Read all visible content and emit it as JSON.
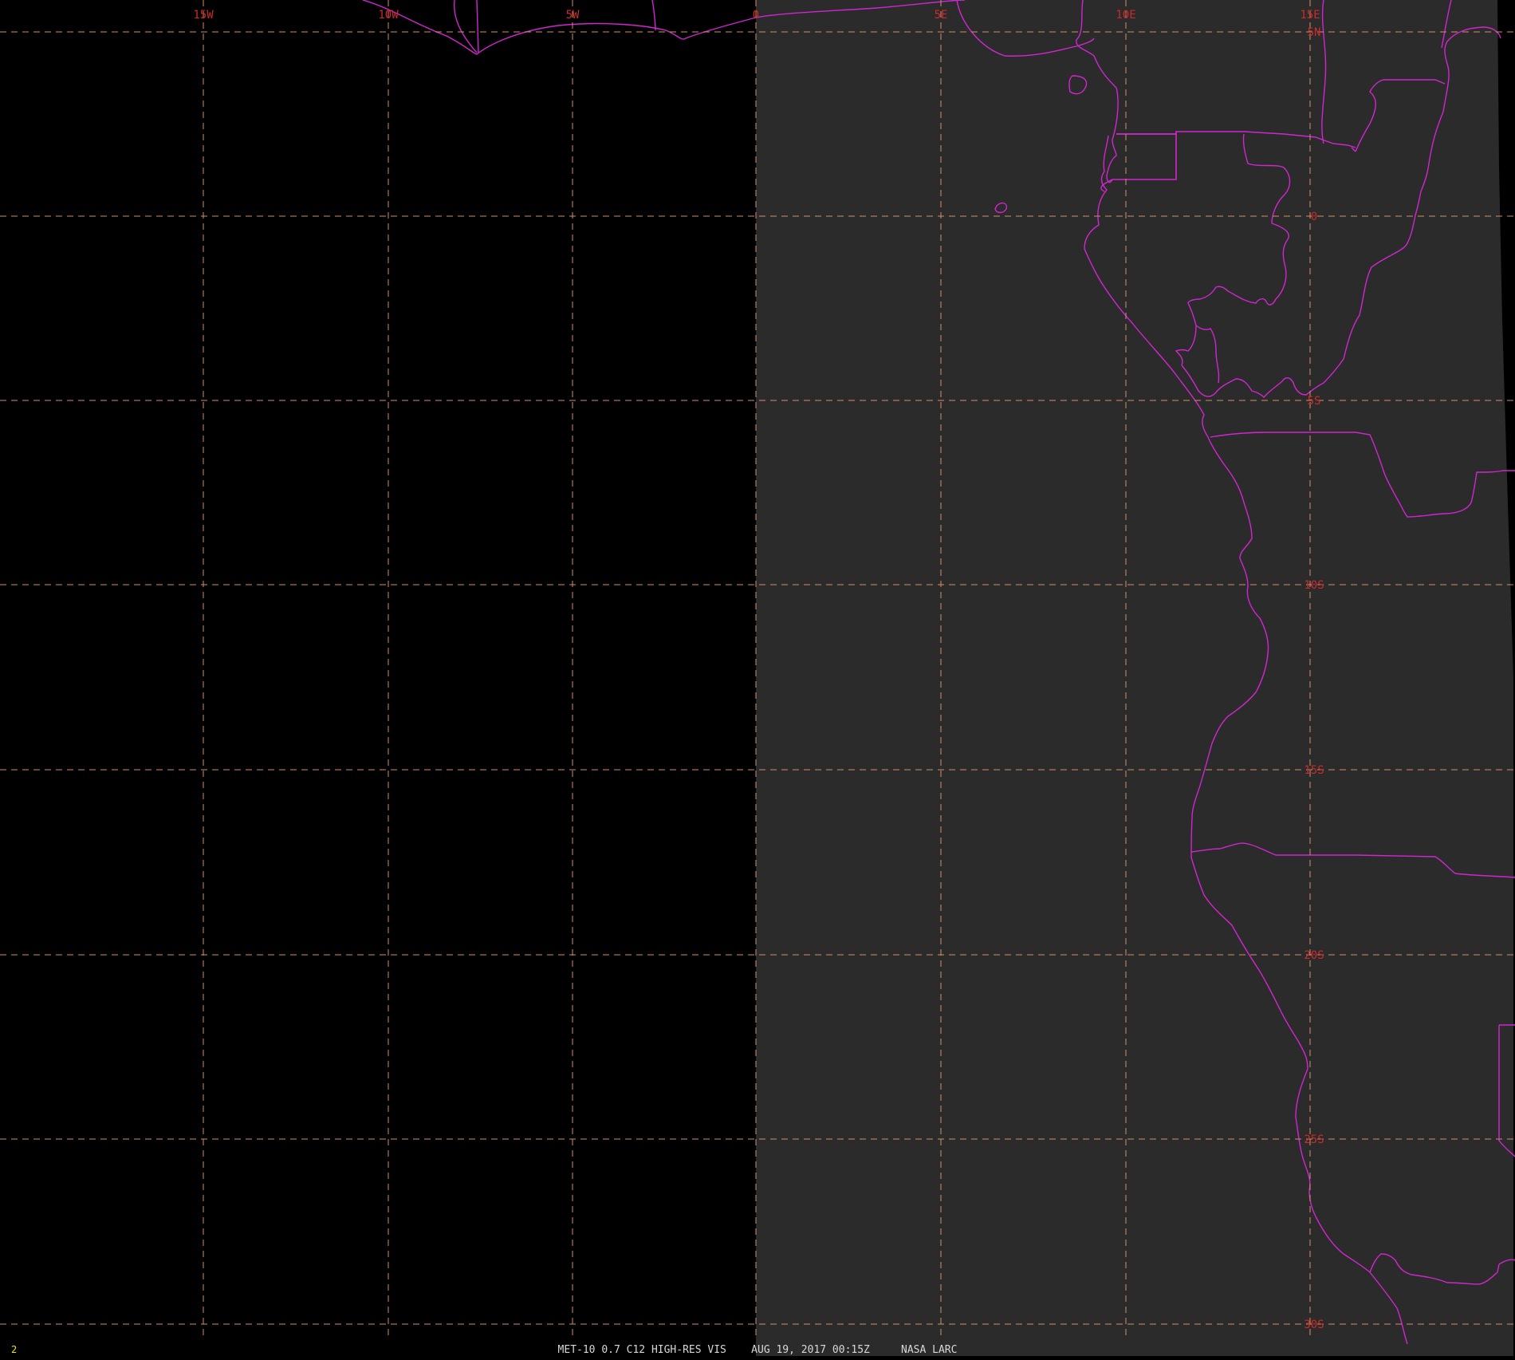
{
  "meta": {
    "frame_number": "2",
    "caption": "MET-10 0.7 C12 HIGH-RES VIS    AUG 19, 2017 00:15Z     NASA LARC"
  },
  "colors": {
    "background": "#000000",
    "earth_disk": "#2b2b2b",
    "boundaries": "#d026d0",
    "grid": "#d0906a",
    "grid_labels": "#cc2a2a",
    "caption": "#d8d8d8",
    "frame_number": "#e6e600"
  },
  "grid": {
    "longitudes": [
      {
        "label": "15W"
      },
      {
        "label": "10W"
      },
      {
        "label": "5W"
      },
      {
        "label": "0"
      },
      {
        "label": "5E"
      },
      {
        "label": "10E"
      },
      {
        "label": "15E"
      }
    ],
    "latitudes": [
      {
        "label": "5N"
      },
      {
        "label": "0"
      },
      {
        "label": "5S"
      },
      {
        "label": "10S"
      },
      {
        "label": "15S"
      },
      {
        "label": "20S"
      },
      {
        "label": "25S"
      },
      {
        "label": "30S"
      }
    ]
  },
  "map_features": [
    {
      "name": "coastline"
    },
    {
      "name": "national-borders"
    },
    {
      "name": "islands"
    }
  ]
}
